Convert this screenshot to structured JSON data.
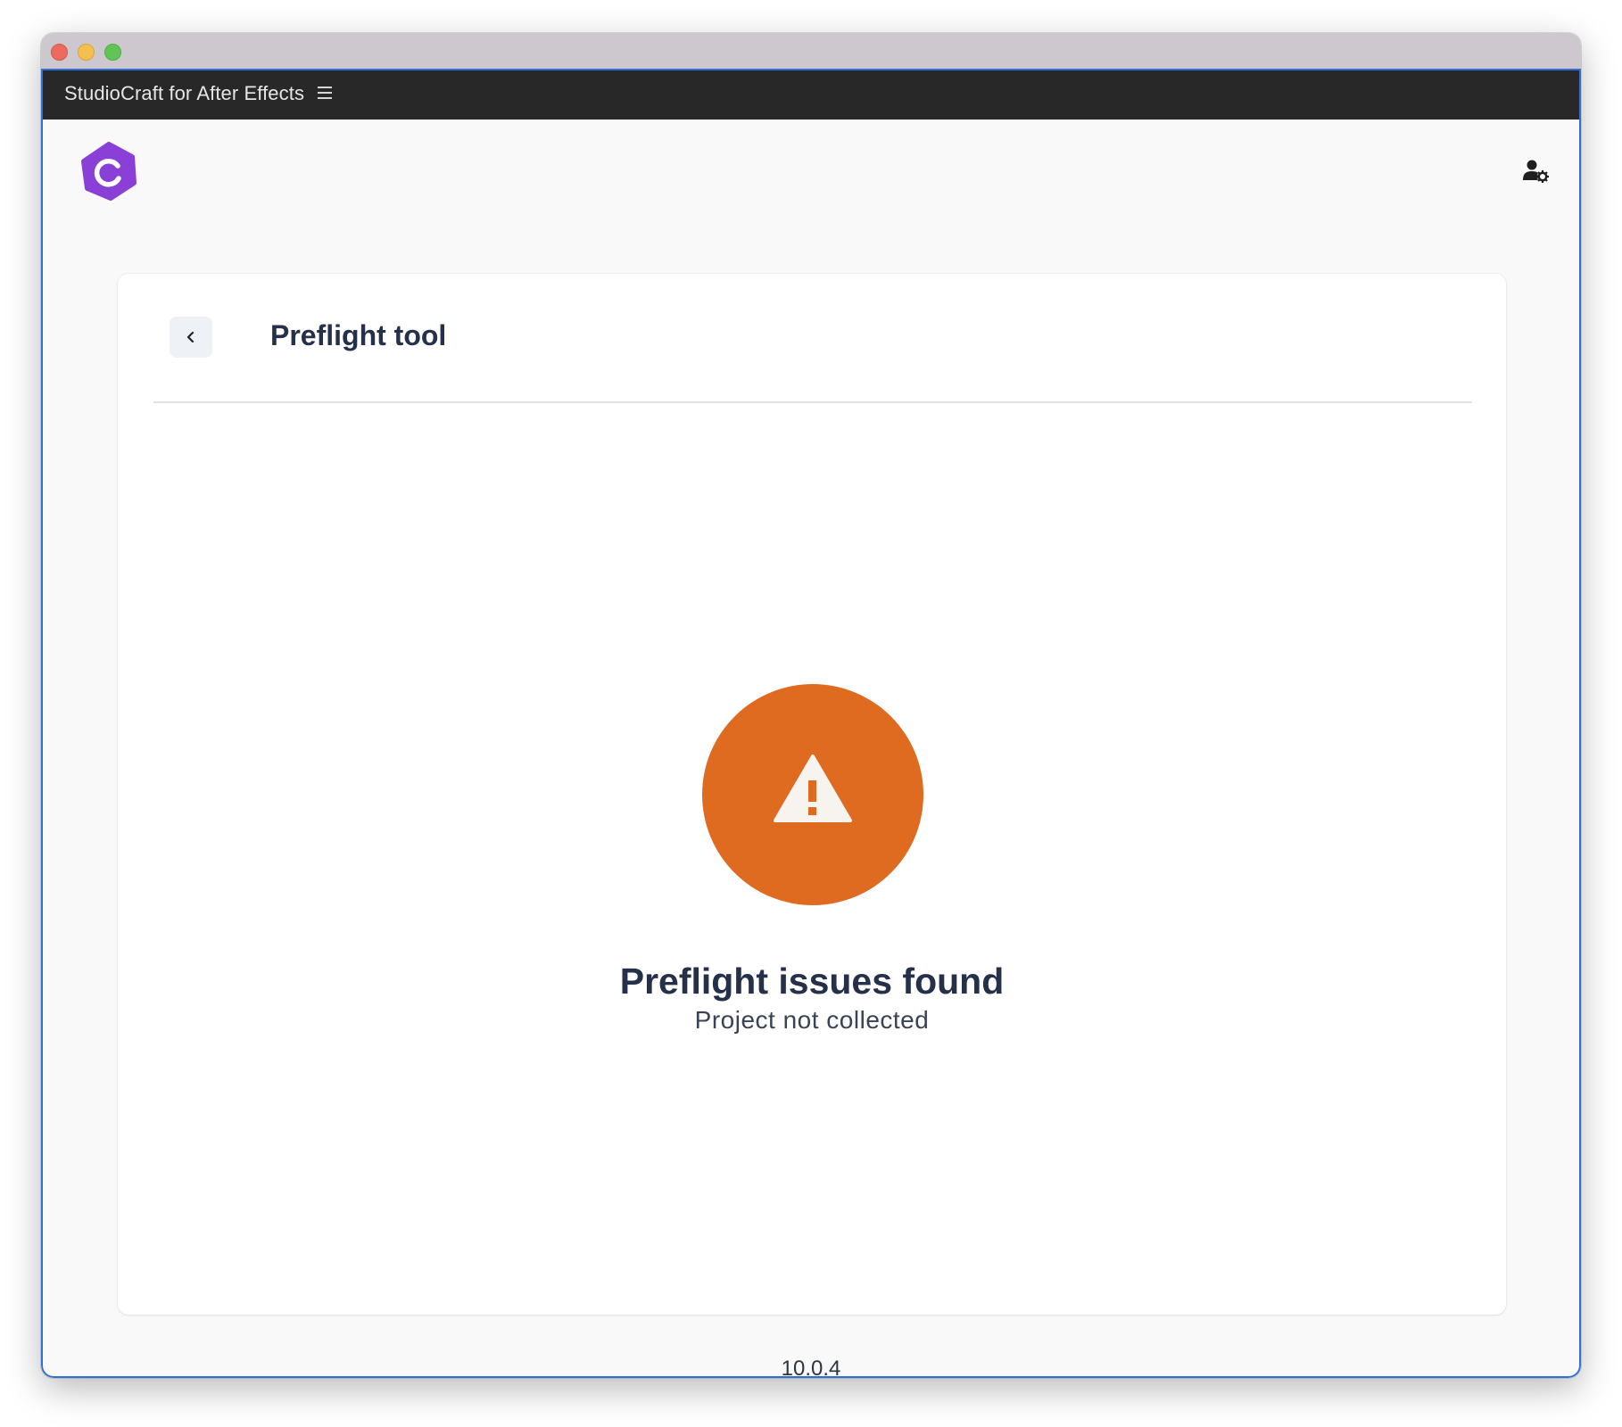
{
  "window": {
    "controls": [
      "close",
      "minimize",
      "zoom"
    ]
  },
  "app_bar": {
    "title": "StudioCraft for After Effects",
    "menu_icon": "hamburger-menu-icon"
  },
  "header": {
    "logo_icon": "studiocraft-logo-icon",
    "user_settings_icon": "user-settings-icon"
  },
  "card": {
    "back_icon": "chevron-left-icon",
    "title": "Preflight tool",
    "status": {
      "icon": "warning-triangle-icon",
      "color": "#de6b20",
      "title": "Preflight issues found",
      "subtitle": "Project not collected"
    }
  },
  "footer": {
    "version": "10.0.4"
  },
  "colors": {
    "accent": "#8a3fd6",
    "warning": "#de6b20",
    "app_bar": "#282828",
    "text_dark": "#25304a"
  }
}
